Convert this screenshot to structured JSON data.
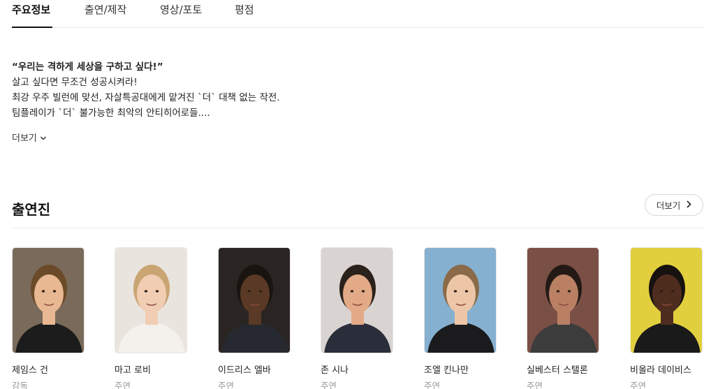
{
  "tabs": [
    {
      "label": "주요정보",
      "active": true
    },
    {
      "label": "출연/제작",
      "active": false
    },
    {
      "label": "영상/포토",
      "active": false
    },
    {
      "label": "평점",
      "active": false
    }
  ],
  "synopsis": {
    "headline": "“우리는 격하게 세상을 구하고 싶다!”",
    "lines": [
      "살고 싶다면 무조건 성공시켜라!",
      "최강 우주 빌런에 맞선, 자살특공대에게 맡겨진 `더` 대책 없는 작전.",
      "팀플레이가 `더` 불가능한 최악의 안티히어로들...."
    ],
    "more_label": "더보기"
  },
  "cast": {
    "title": "출연진",
    "more_label": "더보기",
    "members": [
      {
        "name": "제임스 건",
        "role": "감독",
        "bg": "#7a6a5a",
        "skin": "#e7b892",
        "hair": "#6b4a2a",
        "shirt": "#1c1c1c"
      },
      {
        "name": "마고 로비",
        "role": "주연",
        "bg": "#e9e4de",
        "skin": "#f1cdb4",
        "hair": "#c9a574",
        "shirt": "#f4f1ec"
      },
      {
        "name": "이드리스 엘바",
        "role": "주연",
        "bg": "#2a2523",
        "skin": "#5a3a26",
        "hair": "#1a1411",
        "shirt": "#262a30"
      },
      {
        "name": "존 시나",
        "role": "주연",
        "bg": "#d9d4d2",
        "skin": "#e3aa87",
        "hair": "#2a211b",
        "shirt": "#2a2e3a"
      },
      {
        "name": "조엘 킨나만",
        "role": "주연",
        "bg": "#86b0cf",
        "skin": "#edc6a8",
        "hair": "#8a6a48",
        "shirt": "#1b1b1d"
      },
      {
        "name": "실베스터 스탤론",
        "role": "주연",
        "bg": "#7a4f45",
        "skin": "#b98064",
        "hair": "#231a16",
        "shirt": "#3c3c3c"
      },
      {
        "name": "비올라 데이비스",
        "role": "주연",
        "bg": "#e2cf3e",
        "skin": "#4f2d1e",
        "hair": "#171210",
        "shirt": "#1a1a1a"
      }
    ]
  }
}
